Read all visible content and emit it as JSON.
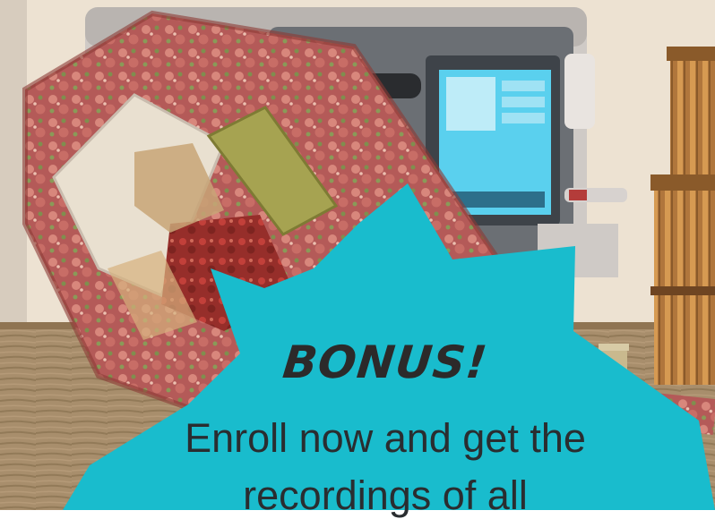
{
  "photo": {
    "subject": "quilted-fabric-bag-icon",
    "background_object": "sewing-machine-icon"
  },
  "badge": {
    "headline": "BONUS!",
    "text_line_1": "Enroll now and get the",
    "text_line_2": "recordings of all"
  },
  "colors": {
    "badge_fill": "#19bccd",
    "fabric_red": "#b45a58",
    "fabric_border": "#8c3a36",
    "machine_screen": "#5ad0ee",
    "table_wood": "#a88e6c",
    "wall": "#ede2d2"
  }
}
